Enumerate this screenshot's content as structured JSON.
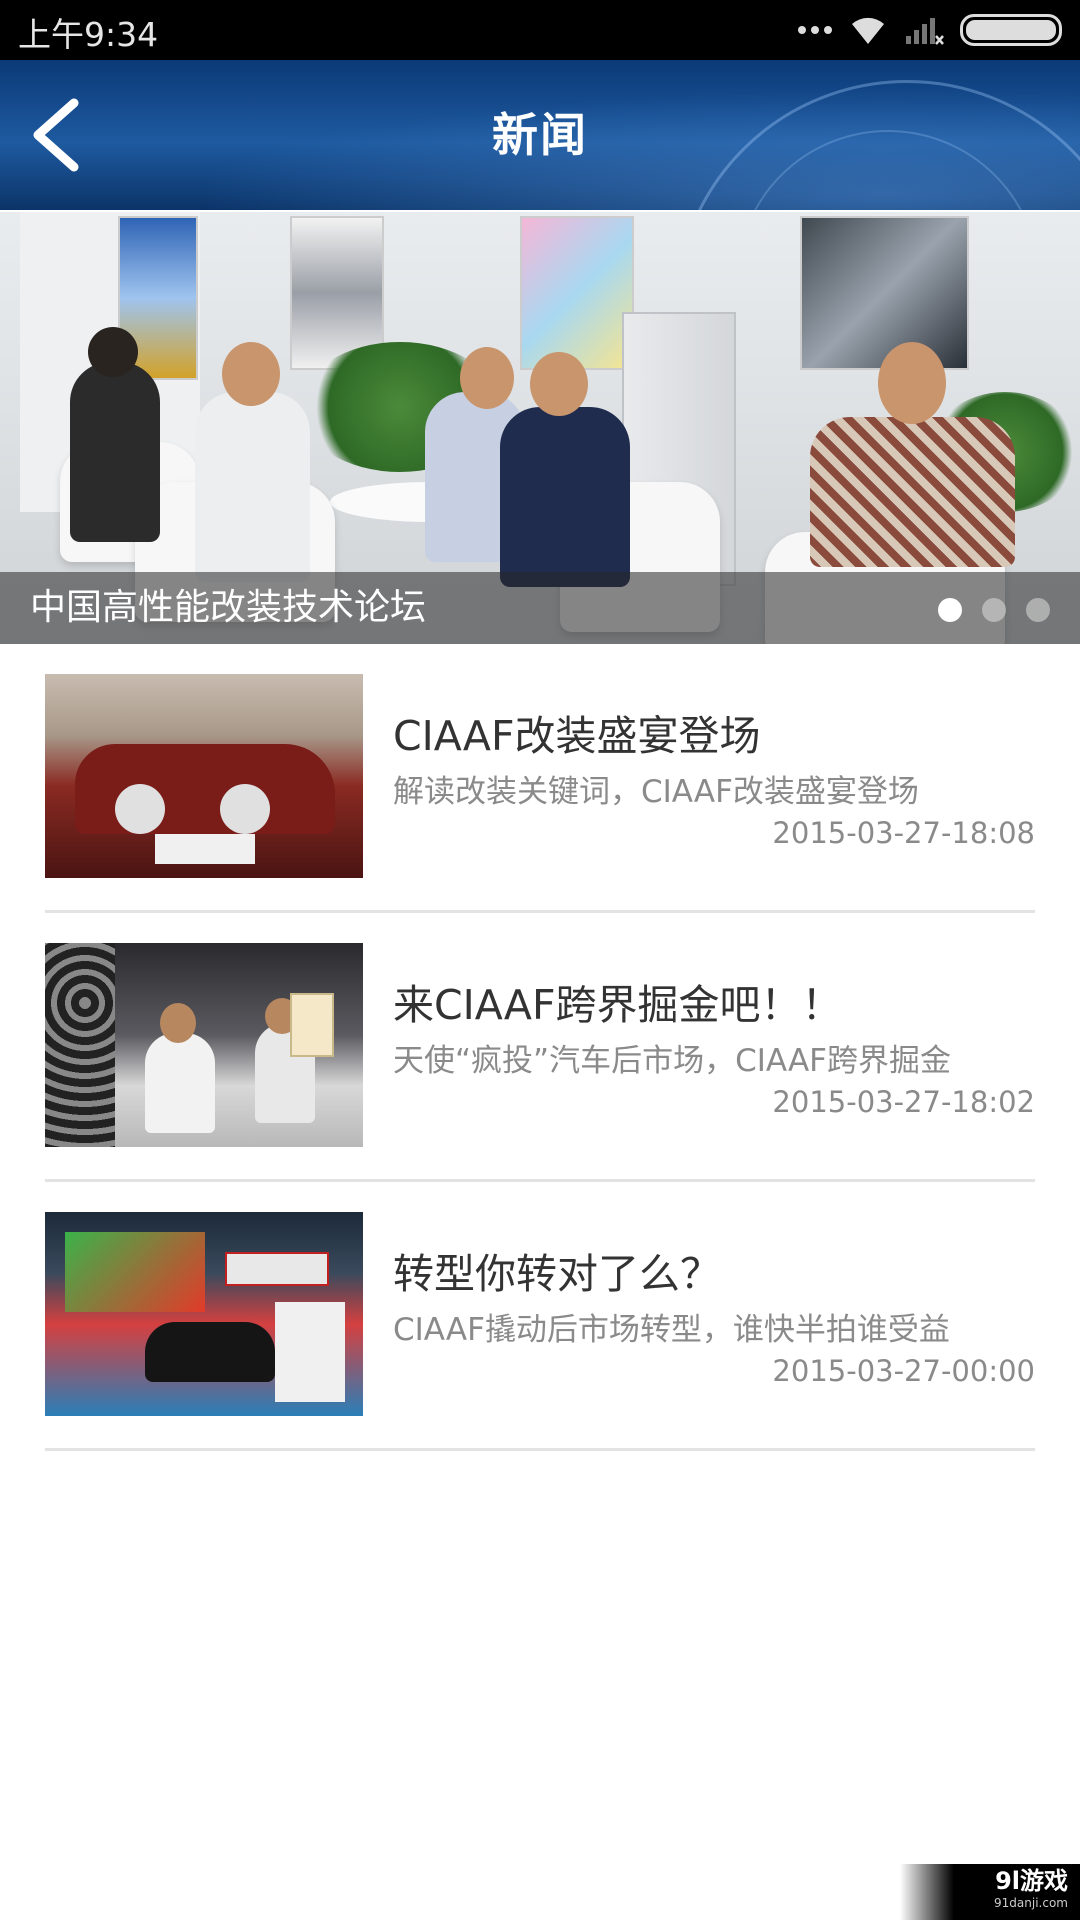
{
  "status_bar": {
    "time": "上午9:34"
  },
  "header": {
    "title": "新闻"
  },
  "banner": {
    "caption": "中国高性能改装技术论坛",
    "pages": 3,
    "active_page": 1
  },
  "news": [
    {
      "title": "CIAAF改装盛宴登场",
      "summary": "解读改装关键词，CIAAF改装盛宴登场",
      "date": "2015-03-27-18:08"
    },
    {
      "title": "来CIAAF跨界掘金吧！！",
      "summary": "天使“疯投”汽车后市场，CIAAF跨界掘金",
      "date": "2015-03-27-18:02"
    },
    {
      "title": "转型你转对了么？",
      "summary": "CIAAF撬动后市场转型，谁快半拍谁受益",
      "date": "2015-03-27-00:00"
    }
  ],
  "watermark": {
    "main": "9l游戏",
    "sub": "91danji.com"
  }
}
